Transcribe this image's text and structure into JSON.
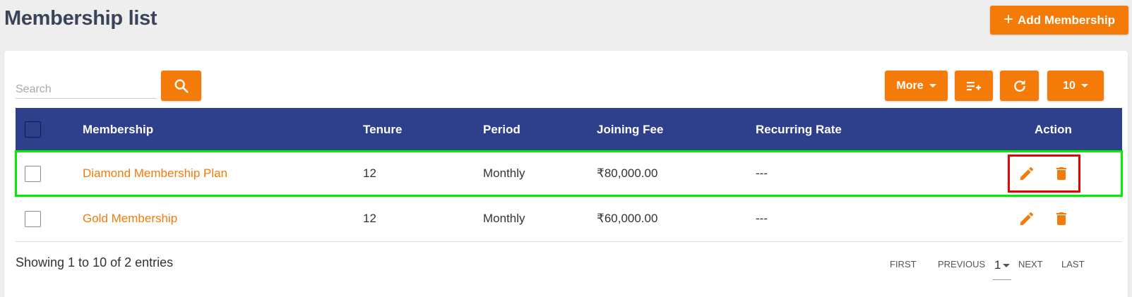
{
  "header": {
    "title": "Membership list",
    "add_button_label": "Add Membership",
    "add_icon": "plus-icon"
  },
  "toolbar": {
    "search_placeholder": "Search",
    "search_icon": "search-icon",
    "more_label": "More",
    "add_column_icon": "playlist-add-icon",
    "refresh_icon": "refresh-icon",
    "page_size": "10"
  },
  "table": {
    "columns": [
      "Membership",
      "Tenure",
      "Period",
      "Joining Fee",
      "Recurring Rate",
      "Action"
    ],
    "rows": [
      {
        "membership": "Diamond Membership Plan",
        "tenure": "12",
        "period": "Monthly",
        "joining_fee": "₹80,000.00",
        "recurring_rate": "---"
      },
      {
        "membership": "Gold Membership",
        "tenure": "12",
        "period": "Monthly",
        "joining_fee": "₹60,000.00",
        "recurring_rate": "---"
      }
    ],
    "action_icons": [
      "edit-icon",
      "trash-icon"
    ]
  },
  "footer": {
    "summary": "Showing 1 to 10 of 2 entries",
    "first_label": "FIRST",
    "previous_label": "PREVIOUS",
    "current_page": "1",
    "next_label": "NEXT",
    "last_label": "LAST"
  },
  "colors": {
    "accent": "#f47b08",
    "header_bg": "#2e3f8c",
    "highlight_row": "#00ee00",
    "highlight_actions": "#ee0000"
  }
}
